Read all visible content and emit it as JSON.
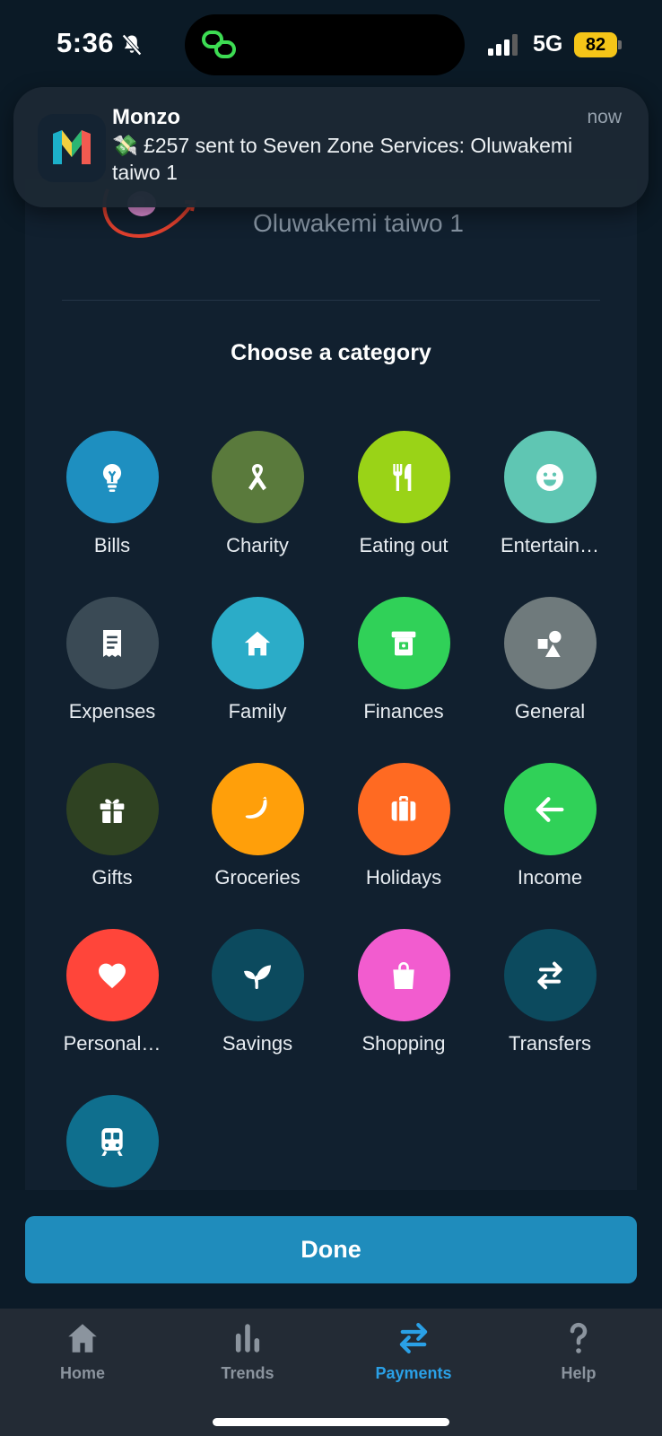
{
  "status_bar": {
    "time": "5:36",
    "network": "5G",
    "battery": "82",
    "icons": [
      "bell-slash-icon",
      "link-icon",
      "signal-icon",
      "battery-icon"
    ]
  },
  "notification": {
    "app": "Monzo",
    "time": "now",
    "body": "💸 £257 sent to Seven Zone Services: Oluwakemi taiwo 1",
    "icon": "monzo-logo"
  },
  "payment": {
    "reference": "Oluwakemi taiwo 1"
  },
  "section_title": "Choose a category",
  "categories": [
    {
      "label": "Bills",
      "color": "#1e8fc0",
      "icon": "lightbulb-icon"
    },
    {
      "label": "Charity",
      "color": "#5a7a3c",
      "icon": "ribbon-icon"
    },
    {
      "label": "Eating out",
      "color": "#9ad317",
      "icon": "cutlery-icon"
    },
    {
      "label": "Entertain…",
      "color": "#5fc6b3",
      "icon": "smiley-icon"
    },
    {
      "label": "Expenses",
      "color": "#3a4a55",
      "icon": "receipt-icon"
    },
    {
      "label": "Family",
      "color": "#2bacc8",
      "icon": "house-icon"
    },
    {
      "label": "Finances",
      "color": "#30d158",
      "icon": "cash-icon"
    },
    {
      "label": "General",
      "color": "#6f7a7c",
      "icon": "shapes-icon"
    },
    {
      "label": "Gifts",
      "color": "#2f4222",
      "icon": "gift-icon"
    },
    {
      "label": "Groceries",
      "color": "#ff9f0a",
      "icon": "banana-icon"
    },
    {
      "label": "Holidays",
      "color": "#ff6a22",
      "icon": "suitcase-icon"
    },
    {
      "label": "Income",
      "color": "#30d158",
      "icon": "arrow-left-icon"
    },
    {
      "label": "Personal…",
      "color": "#ff453a",
      "icon": "heart-icon"
    },
    {
      "label": "Savings",
      "color": "#0c4a5e",
      "icon": "sprout-icon"
    },
    {
      "label": "Shopping",
      "color": "#f25ccf",
      "icon": "shopping-bag-icon"
    },
    {
      "label": "Transfers",
      "color": "#0c4a5e",
      "icon": "swap-arrows-icon"
    },
    {
      "label": "",
      "color": "#0f6f8e",
      "icon": "train-icon"
    }
  ],
  "done_button": "Done",
  "tabs": [
    {
      "label": "Home",
      "icon": "house-icon",
      "active": false
    },
    {
      "label": "Trends",
      "icon": "bar-chart-icon",
      "active": false
    },
    {
      "label": "Payments",
      "icon": "swap-arrows-icon",
      "active": true
    },
    {
      "label": "Help",
      "icon": "question-icon",
      "active": false
    }
  ]
}
